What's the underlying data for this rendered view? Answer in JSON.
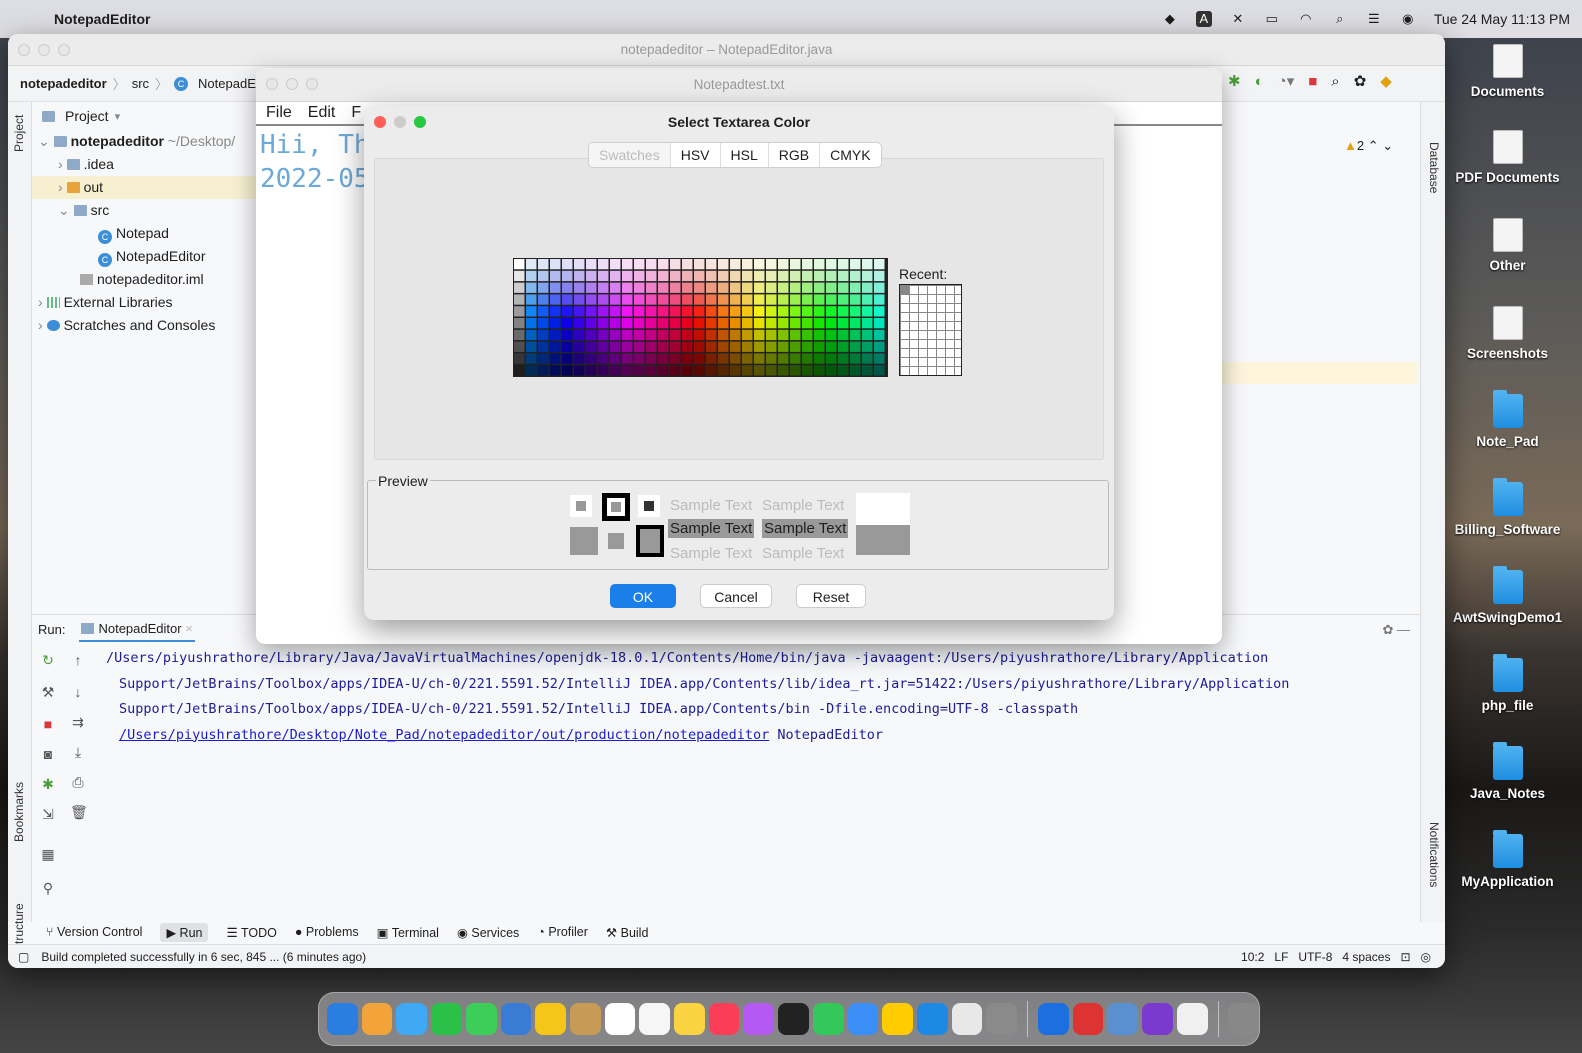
{
  "menubar": {
    "app": "NotepadEditor",
    "datetime": "Tue 24 May  11:13 PM"
  },
  "desktop": [
    {
      "label": "Documents",
      "kind": "doc"
    },
    {
      "label": "PDF Documents",
      "kind": "doc"
    },
    {
      "label": "Other",
      "kind": "doc"
    },
    {
      "label": "Screenshots",
      "kind": "doc"
    },
    {
      "label": "Note_Pad",
      "kind": "folder"
    },
    {
      "label": "Billing_Software",
      "kind": "folder"
    },
    {
      "label": "AwtSwingDemo1",
      "kind": "folder"
    },
    {
      "label": "php_file",
      "kind": "folder"
    },
    {
      "label": "Java_Notes",
      "kind": "folder"
    },
    {
      "label": "MyApplication",
      "kind": "folder"
    }
  ],
  "ide": {
    "title": "notepadeditor – NotepadEditor.java",
    "breadcrumb": {
      "project": "notepadeditor",
      "src": "src",
      "file": "NotepadEdi"
    },
    "project_label": "Project",
    "tree": [
      {
        "label": "notepadeditor",
        "extra": "~/Desktop/",
        "bold": true
      },
      {
        "label": ".idea"
      },
      {
        "label": "out"
      },
      {
        "label": "src"
      },
      {
        "label": "Notepad"
      },
      {
        "label": "NotepadEditor"
      },
      {
        "label": "notepadeditor.iml"
      },
      {
        "label": "External Libraries"
      },
      {
        "label": "Scratches and Consoles"
      }
    ],
    "side_tabs": {
      "project": "Project",
      "bookmarks": "Bookmarks",
      "structure": "Structure",
      "database": "Database",
      "notifications": "Notifications"
    },
    "warnings": "2",
    "run": {
      "label": "Run:",
      "config": "NotepadEditor"
    },
    "console": [
      "/Users/piyushrathore/Library/Java/JavaVirtualMachines/openjdk-18.0.1/Contents/Home/bin/java -javaagent:/Users/piyushrathore/Library/Application",
      "Support/JetBrains/Toolbox/apps/IDEA-U/ch-0/221.5591.52/IntelliJ IDEA.app/Contents/lib/idea_rt.jar=51422:/Users/piyushrathore/Library/Application",
      "Support/JetBrains/Toolbox/apps/IDEA-U/ch-0/221.5591.52/IntelliJ IDEA.app/Contents/bin -Dfile.encoding=UTF-8 -classpath"
    ],
    "console_link": "/Users/piyushrathore/Desktop/Note_Pad/notepadeditor/out/production/notepadeditor",
    "console_tail": " NotepadEditor",
    "toolbar": [
      "Version Control",
      "Run",
      "TODO",
      "Problems",
      "Terminal",
      "Services",
      "Profiler",
      "Build"
    ],
    "status": {
      "msg": "Build completed successfully in 6 sec, 845 ... (6 minutes ago)",
      "pos": "10:2",
      "le": "LF",
      "enc": "UTF-8",
      "indent": "4 spaces"
    }
  },
  "notepad": {
    "title": "Notepadtest.txt",
    "menu": [
      "File",
      "Edit",
      "F"
    ],
    "line1": "Hii, Th",
    "line2": "2022-05"
  },
  "dialog": {
    "title": "Select Textarea Color",
    "tabs": [
      "Swatches",
      "HSV",
      "HSL",
      "RGB",
      "CMYK"
    ],
    "recent_label": "Recent:",
    "preview_label": "Preview",
    "sample": "Sample Text",
    "buttons": {
      "ok": "OK",
      "cancel": "Cancel",
      "reset": "Reset"
    }
  },
  "colors": {
    "accent": "#1a7fe8",
    "console": "#1c1c99"
  }
}
